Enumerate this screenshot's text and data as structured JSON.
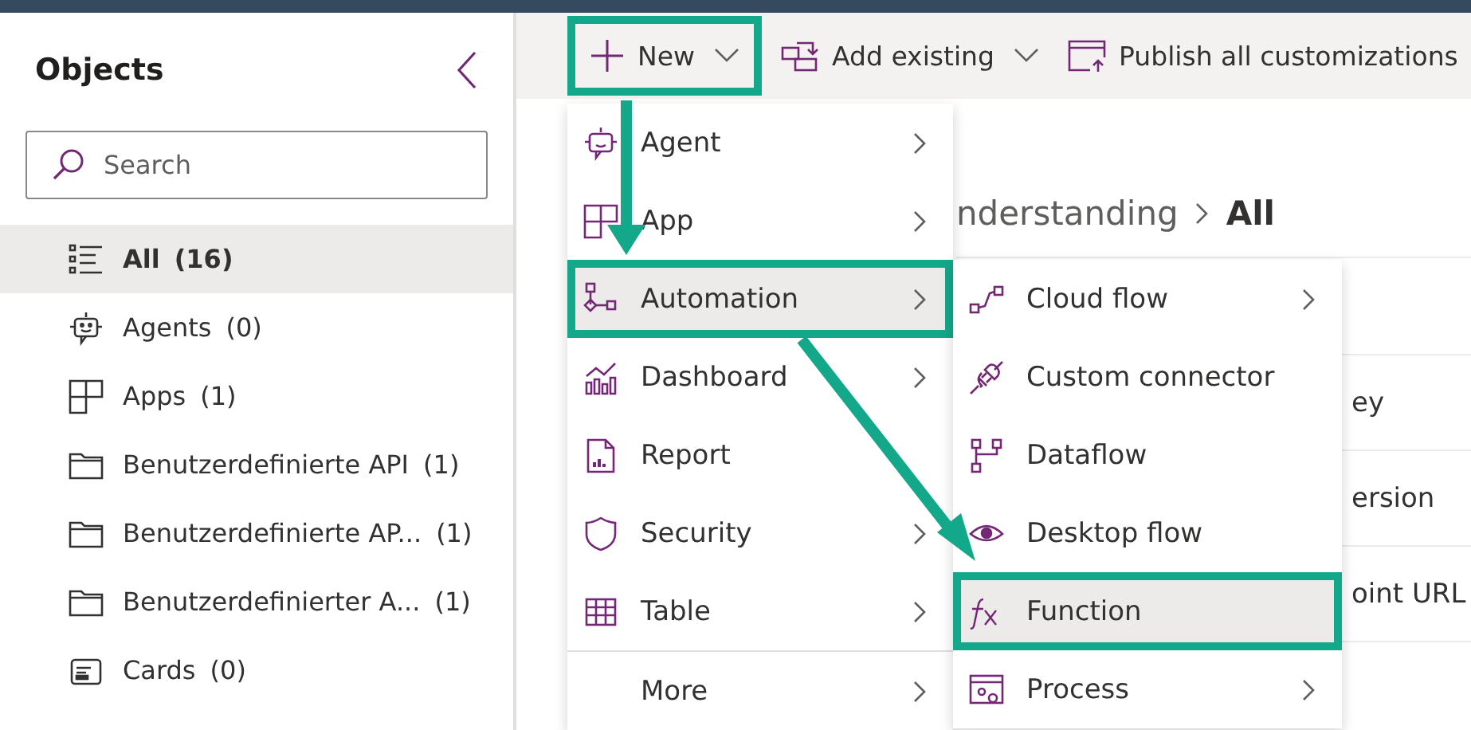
{
  "sidebar": {
    "title": "Objects",
    "search": {
      "placeholder": "Search"
    },
    "items": [
      {
        "kind": "list",
        "label": "All",
        "count": "(16)",
        "selected": true
      },
      {
        "kind": "agent",
        "label": "Agents",
        "count": "(0)",
        "selected": false
      },
      {
        "kind": "app",
        "label": "Apps",
        "count": "(1)",
        "selected": false
      },
      {
        "kind": "folder",
        "label": "Benutzerdefinierte API",
        "count": "(1)",
        "selected": false
      },
      {
        "kind": "folder",
        "label": "Benutzerdefinierte AP...",
        "count": "(1)",
        "selected": false
      },
      {
        "kind": "folder",
        "label": "Benutzerdefinierter A...",
        "count": "(1)",
        "selected": false
      },
      {
        "kind": "card",
        "label": "Cards",
        "count": "(0)",
        "selected": false
      }
    ]
  },
  "toolbar": {
    "buttons": [
      {
        "kind": "new",
        "label": "New",
        "dropdown": true,
        "highlighted": true
      },
      {
        "kind": "add",
        "label": "Add existing",
        "dropdown": true,
        "highlighted": false
      },
      {
        "kind": "publish",
        "label": "Publish all customizations",
        "dropdown": false,
        "highlighted": false
      }
    ]
  },
  "breadcrumb": {
    "parent": "nderstanding",
    "current": "All"
  },
  "table": {
    "rows": [
      {
        "column_1": "ey"
      },
      {
        "column_1": "ersion"
      },
      {
        "column_1": "oint URL"
      }
    ]
  },
  "new_menu": {
    "items": [
      {
        "kind": "agent",
        "label": "Agent",
        "submenu": true,
        "highlighted": false
      },
      {
        "kind": "app",
        "label": "App",
        "submenu": true,
        "highlighted": false
      },
      {
        "kind": "automation",
        "label": "Automation",
        "submenu": true,
        "highlighted": true
      },
      {
        "kind": "dashboard",
        "label": "Dashboard",
        "submenu": true,
        "highlighted": false
      },
      {
        "kind": "report",
        "label": "Report",
        "submenu": false,
        "highlighted": false
      },
      {
        "kind": "security",
        "label": "Security",
        "submenu": true,
        "highlighted": false
      },
      {
        "kind": "table",
        "label": "Table",
        "submenu": true,
        "highlighted": false
      },
      {
        "kind": "more",
        "label": "More",
        "submenu": true,
        "highlighted": false
      }
    ]
  },
  "automation_menu": {
    "items": [
      {
        "kind": "cloud",
        "label": "Cloud flow",
        "submenu": true,
        "highlighted": false
      },
      {
        "kind": "connector",
        "label": "Custom connector",
        "submenu": false,
        "highlighted": false
      },
      {
        "kind": "dataflow",
        "label": "Dataflow",
        "submenu": false,
        "highlighted": false
      },
      {
        "kind": "desktop",
        "label": "Desktop flow",
        "submenu": false,
        "highlighted": false
      },
      {
        "kind": "function",
        "label": "Function",
        "submenu": false,
        "highlighted": true
      },
      {
        "kind": "process",
        "label": "Process",
        "submenu": true,
        "highlighted": false
      }
    ]
  }
}
